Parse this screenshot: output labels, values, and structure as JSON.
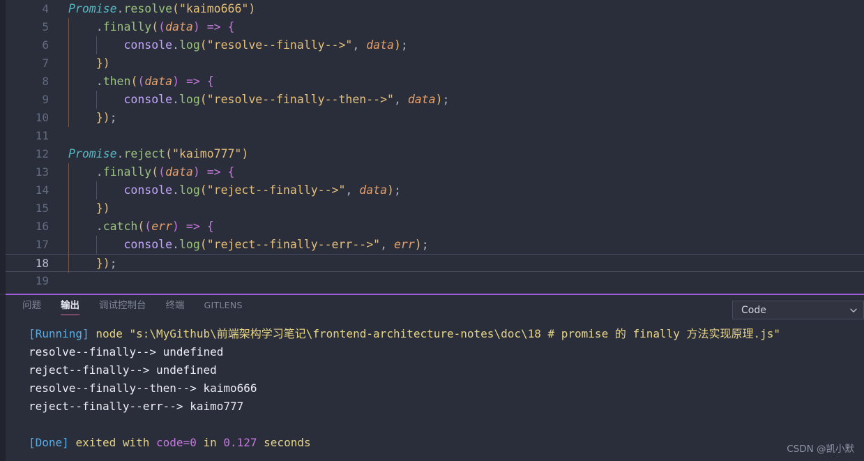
{
  "theme": {
    "editor_bg": "#2a2d3a",
    "panel_bg": "#2a2d3a",
    "strip_bg": "#21232e",
    "panel_border": "#9d5ddb",
    "active_tab_underline": "#e06c9f",
    "active_line_border": "#4a4f63",
    "indent_guide": "#4b5263",
    "indent_guide_active": "#7c5a4a"
  },
  "editor": {
    "active_line": 18,
    "first_visible_line": 4,
    "lines": [
      {
        "num": "4",
        "indent": 0,
        "text": "Promise.resolve(\"kaimo666\")"
      },
      {
        "num": "5",
        "indent": 1,
        "text": "    .finally((data) => {"
      },
      {
        "num": "6",
        "indent": 2,
        "text": "        console.log(\"resolve--finally-->\", data);"
      },
      {
        "num": "7",
        "indent": 1,
        "text": "    })"
      },
      {
        "num": "8",
        "indent": 1,
        "text": "    .then((data) => {"
      },
      {
        "num": "9",
        "indent": 2,
        "text": "        console.log(\"resolve--finally--then-->\", data);"
      },
      {
        "num": "10",
        "indent": 1,
        "text": "    });"
      },
      {
        "num": "11",
        "indent": 0,
        "text": ""
      },
      {
        "num": "12",
        "indent": 0,
        "text": "Promise.reject(\"kaimo777\")"
      },
      {
        "num": "13",
        "indent": 1,
        "text": "    .finally((data) => {"
      },
      {
        "num": "14",
        "indent": 2,
        "text": "        console.log(\"reject--finally-->\", data);"
      },
      {
        "num": "15",
        "indent": 1,
        "text": "    })"
      },
      {
        "num": "16",
        "indent": 1,
        "text": "    .catch((err) => {"
      },
      {
        "num": "17",
        "indent": 2,
        "text": "        console.log(\"reject--finally--err-->\", err);"
      },
      {
        "num": "18",
        "indent": 1,
        "text": "    });"
      },
      {
        "num": "19",
        "indent": 0,
        "text": ""
      }
    ]
  },
  "panel": {
    "tabs": [
      {
        "label": "问题",
        "active": false,
        "caps": false
      },
      {
        "label": "输出",
        "active": true,
        "caps": false
      },
      {
        "label": "调试控制台",
        "active": false,
        "caps": false
      },
      {
        "label": "终端",
        "active": false,
        "caps": false
      },
      {
        "label": "GITLENS",
        "active": false,
        "caps": true
      }
    ],
    "channel_select": {
      "value": "Code",
      "icon": "chevron-down-icon"
    },
    "output_lines": [
      {
        "segments": [
          {
            "text": "[Running] ",
            "cls": "o-run"
          },
          {
            "text": "node \"s:\\MyGithub\\前端架构学习笔记\\frontend-architecture-notes\\doc\\18 # promise 的 finally 方法实现原理.js\"",
            "cls": "o-yel"
          }
        ]
      },
      {
        "segments": [
          {
            "text": "resolve--finally--> undefined",
            "cls": "o-plain"
          }
        ]
      },
      {
        "segments": [
          {
            "text": "reject--finally--> undefined",
            "cls": "o-plain"
          }
        ]
      },
      {
        "segments": [
          {
            "text": "resolve--finally--then--> kaimo666",
            "cls": "o-plain"
          }
        ]
      },
      {
        "segments": [
          {
            "text": "reject--finally--err--> kaimo777",
            "cls": "o-plain"
          }
        ]
      },
      {
        "segments": [
          {
            "text": "",
            "cls": "o-plain"
          }
        ]
      },
      {
        "segments": [
          {
            "text": "[Done] ",
            "cls": "o-done"
          },
          {
            "text": "exited with ",
            "cls": "o-yel"
          },
          {
            "text": "code=0",
            "cls": "o-pur"
          },
          {
            "text": " in ",
            "cls": "o-yel"
          },
          {
            "text": "0.127",
            "cls": "o-pur"
          },
          {
            "text": " seconds",
            "cls": "o-yel"
          }
        ]
      }
    ]
  },
  "watermark": {
    "text": "CSDN @凯小默"
  }
}
